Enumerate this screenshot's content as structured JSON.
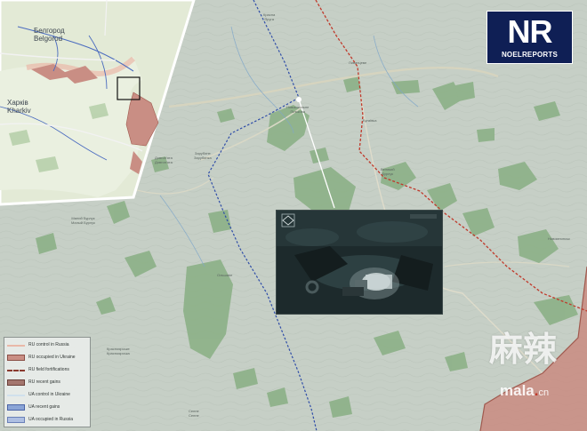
{
  "logo": {
    "letters": "NR",
    "sub": "NOELREPORTS"
  },
  "inset": {
    "cities": [
      {
        "line1": "Белгород",
        "line2": "Belgorod"
      },
      {
        "line1": "Харків",
        "line2": "Kharkiv"
      }
    ]
  },
  "place_labels": [
    {
      "line1": "Красна",
      "line2": "Яруга"
    },
    {
      "line1": "Новошкольне",
      "line2": "Пількова"
    },
    {
      "line1": "Ливинцеве",
      "line2": ""
    },
    {
      "line1": "Бугаївка",
      "line2": ""
    },
    {
      "line1": "Довгоп'ята",
      "line2": "Довгоп'ята"
    },
    {
      "line1": "Зарубине",
      "line2": "Зарубинка"
    },
    {
      "line1": "Великий",
      "line2": "Бурлук"
    },
    {
      "line1": "Малий Бурлук",
      "line2": "Малый Бурлук"
    },
    {
      "line1": "Ольшане",
      "line2": ""
    },
    {
      "line1": "Новомлинськ",
      "line2": ""
    },
    {
      "line1": "Красноярське",
      "line2": "Красноярська"
    },
    {
      "line1": "Сенне",
      "line2": "Сенне"
    }
  ],
  "legend": {
    "items": [
      {
        "label": "RU control in Russia",
        "color": "#e9b8a8",
        "style": "line"
      },
      {
        "label": "RU occupied in Ukraine",
        "color": "#c98e84",
        "style": "fill"
      },
      {
        "label": "RU field fortifications",
        "color": "#8a3a2e",
        "style": "dash"
      },
      {
        "label": "RU recent gains",
        "color": "#a4766e",
        "style": "fill-dark"
      },
      {
        "label": "UA control in Ukraine",
        "color": "#d0e0ec",
        "style": "line"
      },
      {
        "label": "UA recent gains",
        "color": "#8aa4d6",
        "style": "fill"
      },
      {
        "label": "UA occupied in Russia",
        "color": "#aebfe2",
        "style": "fill"
      }
    ]
  },
  "watermark": {
    "chars": "麻辣",
    "site": "mala",
    "tld": "cn"
  },
  "colors": {
    "terrain": "#c6cfc6",
    "forest": "#8fb28a",
    "border_blue": "#2f4da8",
    "frontline_red": "#c0392b",
    "ru_fill": "#c98e84",
    "logo_bg": "#0f1f55"
  }
}
